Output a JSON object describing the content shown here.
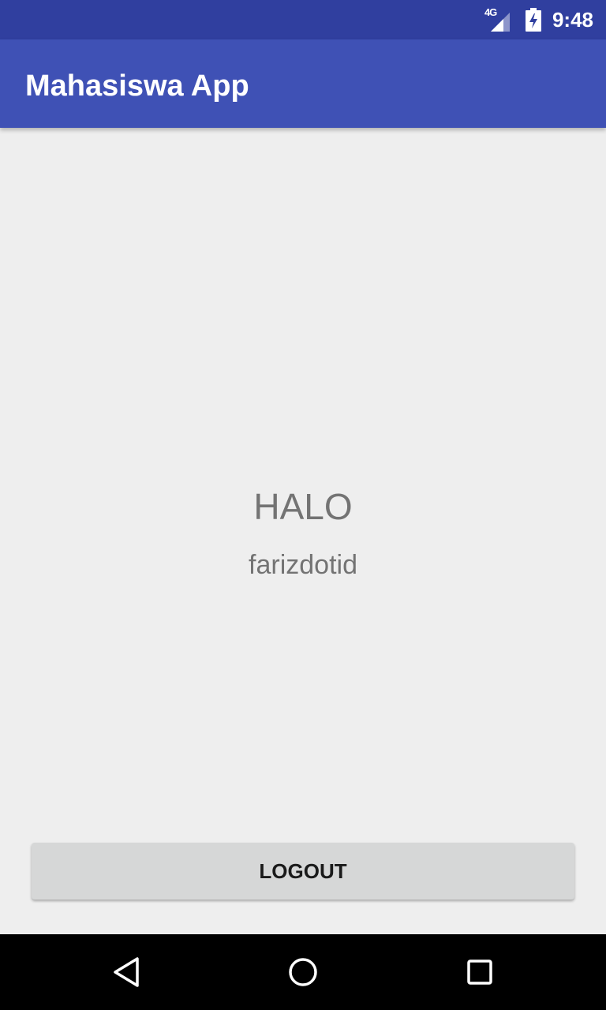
{
  "status_bar": {
    "network_type": "4G",
    "time": "9:48",
    "icons": [
      "signal-icon",
      "battery-charging-icon"
    ]
  },
  "app_bar": {
    "title": "Mahasiswa App"
  },
  "main": {
    "greeting": "HALO",
    "username": "farizdotid"
  },
  "actions": {
    "logout_label": "LOGOUT"
  },
  "nav_bar": {
    "icons": [
      "back-icon",
      "home-icon",
      "recent-apps-icon"
    ]
  },
  "colors": {
    "status_bar": "#303f9f",
    "app_bar": "#3f51b5",
    "background": "#eeeeee",
    "button": "#d6d7d7",
    "text_secondary": "#737373"
  }
}
